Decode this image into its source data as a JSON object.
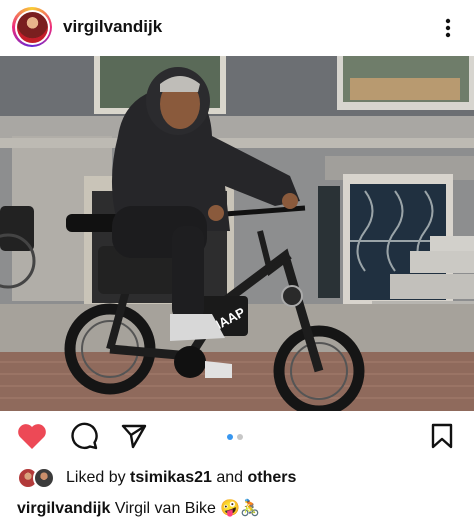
{
  "header": {
    "username": "virgilvandijk",
    "more_icon": "vertical-ellipsis-icon"
  },
  "post": {
    "photo_icon": "photo-man-on-ebike",
    "bike_brand_text": "KNAAP",
    "carousel": {
      "total": 2,
      "current": 1
    }
  },
  "actions": {
    "like_icon": "heart-filled-icon",
    "like_color": "#ed4956",
    "comment_icon": "comment-icon",
    "share_icon": "paper-plane-icon",
    "save_icon": "bookmark-icon"
  },
  "likes": {
    "prefix": "Liked by",
    "user": "tsimikas21",
    "joiner": "and",
    "suffix": "others"
  },
  "caption": {
    "username": "virgilvandijk",
    "text": "Virgil van Bike",
    "emoji": "🤪🚴"
  }
}
